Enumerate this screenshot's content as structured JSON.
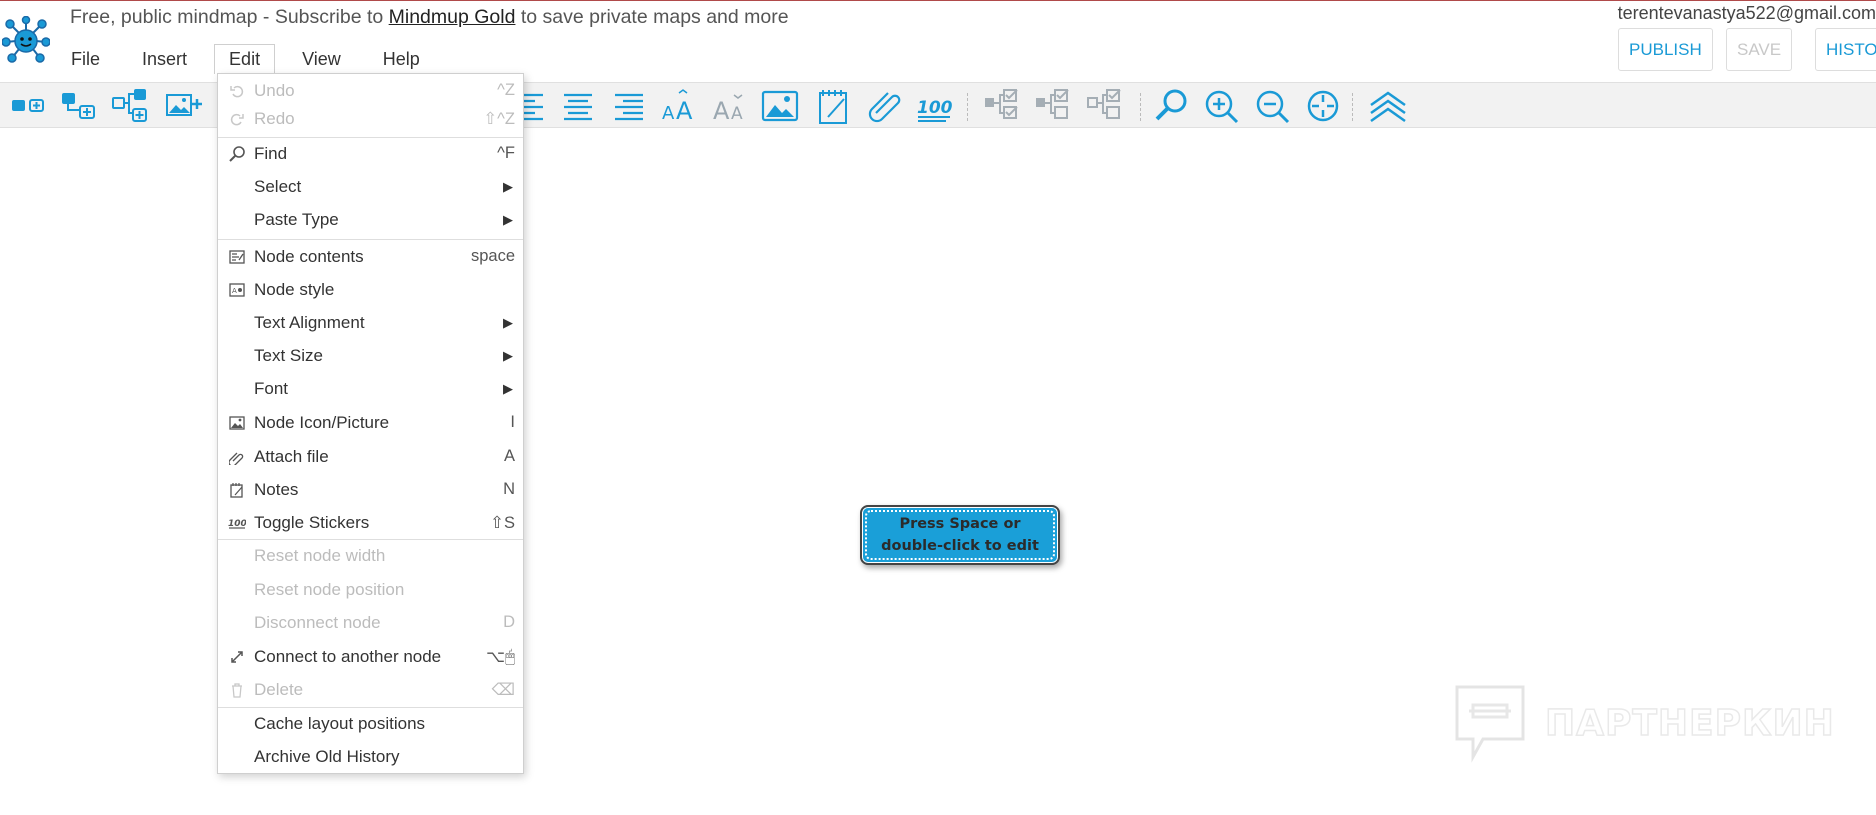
{
  "header": {
    "title_prefix": "Free, public mindmap - Subscribe to ",
    "title_link": "Mindmup Gold",
    "title_suffix": " to save private maps and more",
    "email": "terentevanastya522@gmail.com",
    "publish_label": "PUBLISH",
    "save_label": "SAVE",
    "history_label": "HISTORY"
  },
  "menubar": {
    "items": [
      "File",
      "Insert",
      "Edit",
      "View",
      "Help"
    ],
    "open": "Edit"
  },
  "edit_menu": {
    "items": [
      {
        "label": "Undo",
        "shortcut": "^Z",
        "icon": "undo-icon",
        "disabled": true
      },
      {
        "label": "Redo",
        "shortcut": "⇧^Z",
        "icon": "redo-icon",
        "disabled": true
      },
      {
        "label": "Find",
        "shortcut": "^F",
        "icon": "search-icon"
      },
      {
        "label": "Select",
        "submenu": true
      },
      {
        "label": "Paste Type",
        "submenu": true
      },
      {
        "label": "Node contents",
        "shortcut": "space",
        "icon": "node-contents-icon"
      },
      {
        "label": "Node style",
        "icon": "node-style-icon"
      },
      {
        "label": "Text Alignment",
        "submenu": true
      },
      {
        "label": "Text Size",
        "submenu": true
      },
      {
        "label": "Font",
        "submenu": true
      },
      {
        "label": "Node Icon/Picture",
        "shortcut": "I",
        "icon": "picture-icon"
      },
      {
        "label": "Attach file",
        "shortcut": "A",
        "icon": "paperclip-icon"
      },
      {
        "label": "Notes",
        "shortcut": "N",
        "icon": "notes-icon"
      },
      {
        "label": "Toggle Stickers",
        "shortcut": "⇧S",
        "icon": "sticker-100-icon"
      },
      {
        "label": "Reset node width",
        "disabled": true
      },
      {
        "label": "Reset node position",
        "disabled": true
      },
      {
        "label": "Disconnect node",
        "shortcut": "D",
        "disabled": true
      },
      {
        "label": "Connect to another node",
        "shortcut": "⌥🖱",
        "icon": "connect-icon"
      },
      {
        "label": "Delete",
        "shortcut": "⌫",
        "icon": "trash-icon",
        "disabled": true
      },
      {
        "label": "Cache layout positions"
      },
      {
        "label": "Archive Old History"
      }
    ]
  },
  "toolbar": {
    "tools": [
      "add-child-node-icon",
      "add-sibling-node-icon",
      "add-node-below-icon",
      "add-image-icon",
      "align-left-icon",
      "align-center-icon",
      "align-right-icon",
      "increase-text-size-icon",
      "decrease-text-size-icon",
      "node-picture-icon",
      "notes-icon",
      "attach-icon",
      "sticker-100-icon",
      "checklist-icon",
      "checklist-add-icon",
      "checklist-remove-icon",
      "search-icon",
      "zoom-in-icon",
      "zoom-out-icon",
      "center-icon",
      "collapse-icon"
    ]
  },
  "canvas": {
    "node_text": "Press Space or double-click to edit",
    "watermark_text": "ПАРТНЕРКИН"
  },
  "colors": {
    "accent": "#1a9ad6",
    "node": "#1a9fd8"
  }
}
